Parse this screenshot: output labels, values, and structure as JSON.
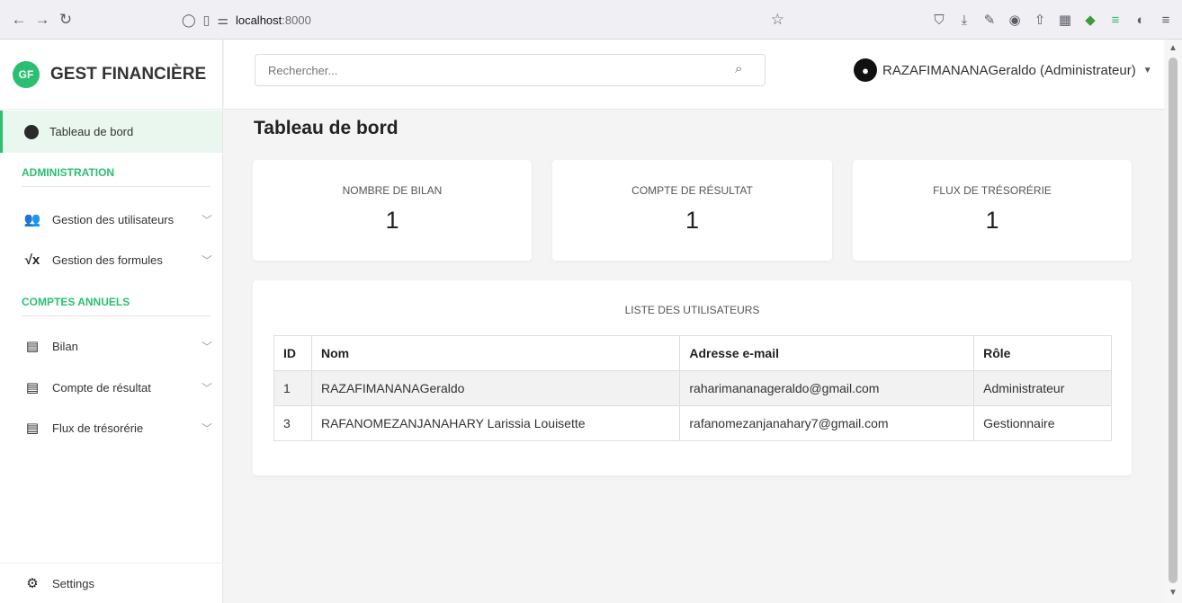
{
  "browser": {
    "url_host": "localhost",
    "url_port": ":8000"
  },
  "sidebar": {
    "brand_logo": "GF",
    "brand_name": "GEST FINANCIÈRE",
    "active_item": "Tableau de bord",
    "section_admin": "ADMINISTRATION",
    "admin_items": [
      {
        "label": "Gestion des utilisateurs",
        "icon": "users-icon"
      },
      {
        "label": "Gestion des formules",
        "icon": "square-root-icon"
      }
    ],
    "section_comptes": "COMPTES ANNUELS",
    "comptes_items": [
      {
        "label": "Bilan",
        "icon": "file-invoice-dollar-icon"
      },
      {
        "label": "Compte de résultat",
        "icon": "file-invoice-dollar-icon"
      },
      {
        "label": "Flux de trésorérie",
        "icon": "file-invoice-dollar-icon"
      }
    ],
    "settings": "Settings"
  },
  "topbar": {
    "search_placeholder": "Rechercher...",
    "user": "RAZAFIMANANAGeraldo (Administrateur)"
  },
  "main": {
    "title": "Tableau de bord",
    "stats": [
      {
        "label": "NOMBRE DE BILAN",
        "value": "1"
      },
      {
        "label": "COMPTE DE RÉSULTAT",
        "value": "1"
      },
      {
        "label": "FLUX DE TRÉSORÉRIE",
        "value": "1"
      }
    ],
    "users_title": "LISTE DES UTILISATEURS",
    "table": {
      "headers": [
        "ID",
        "Nom",
        "Adresse e-mail",
        "Rôle"
      ],
      "rows": [
        [
          "1",
          "RAZAFIMANANAGeraldo",
          "raharimananageraldo@gmail.com",
          "Administrateur"
        ],
        [
          "3",
          "RAFANOMEZANJANAHARY Larissia Louisette",
          "rafanomezanjanahary7@gmail.com",
          "Gestionnaire"
        ]
      ]
    }
  },
  "colors": {
    "accent": "#2bbf71",
    "active_bg": "#e9f7ee"
  }
}
